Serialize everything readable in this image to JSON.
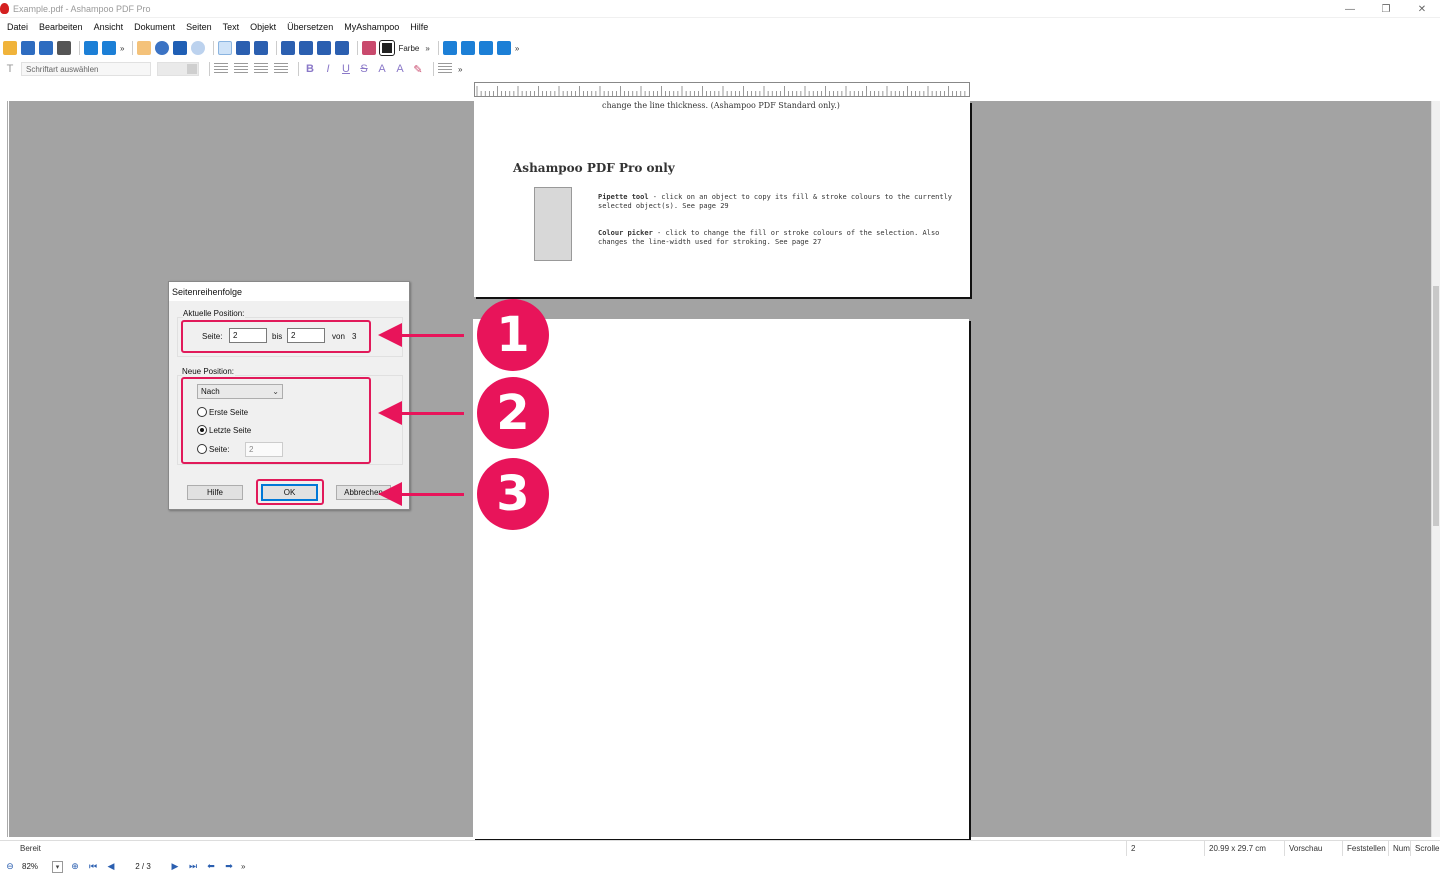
{
  "window": {
    "title": "Example.pdf - Ashampoo PDF Pro",
    "controls": [
      "—",
      "❐",
      "✕"
    ]
  },
  "menu": [
    "Datei",
    "Bearbeiten",
    "Ansicht",
    "Dokument",
    "Seiten",
    "Text",
    "Objekt",
    "Übersetzen",
    "MyAshampoo",
    "Hilfe"
  ],
  "toolbar": {
    "color_label": "Farbe",
    "more": "»",
    "font_placeholder": "Schriftart auswählen"
  },
  "colors": {
    "accent": "#e8145a",
    "workspace": "#a3a3a3",
    "dialog_bg": "#f0f0f0",
    "ok_border": "#0078d7"
  },
  "page": {
    "cut_line": "change the line thickness. (Ashampoo PDF Standard only.)",
    "section_title": "Ashampoo PDF Pro only",
    "tools": [
      {
        "name": "Pipette tool",
        "desc": " - click on an object to copy its fill & stroke colours to the currently selected object(s). See page 29"
      },
      {
        "name": "Colour picker",
        "desc": " - click to change the fill or stroke colours of the selection. Also changes the line-width used for stroking. See page 27"
      }
    ]
  },
  "dialog": {
    "title": "Seitenreihenfolge",
    "current": {
      "legend": "Aktuelle Position:",
      "page_label": "Seite:",
      "page_from": "2",
      "to_label": "bis",
      "page_to": "2",
      "of_label": "von",
      "total": "3"
    },
    "new": {
      "legend": "Neue Position:",
      "mode": "Nach",
      "options": [
        "Erste Seite",
        "Letzte Seite",
        "Seite:"
      ],
      "selected": 1,
      "page_value": "2"
    },
    "buttons": {
      "help": "Hilfe",
      "ok": "OK",
      "cancel": "Abbrechen"
    }
  },
  "annotations": [
    "1",
    "2",
    "3"
  ],
  "status": {
    "ready": "Bereit",
    "page": "2",
    "size": "20.99 x 29.7 cm",
    "mode": "Vorschau",
    "caps": "Feststellen",
    "num": "Num",
    "scroll": "Scrolle"
  },
  "nav": {
    "zoom": "82%",
    "page_indicator": "2 / 3"
  }
}
